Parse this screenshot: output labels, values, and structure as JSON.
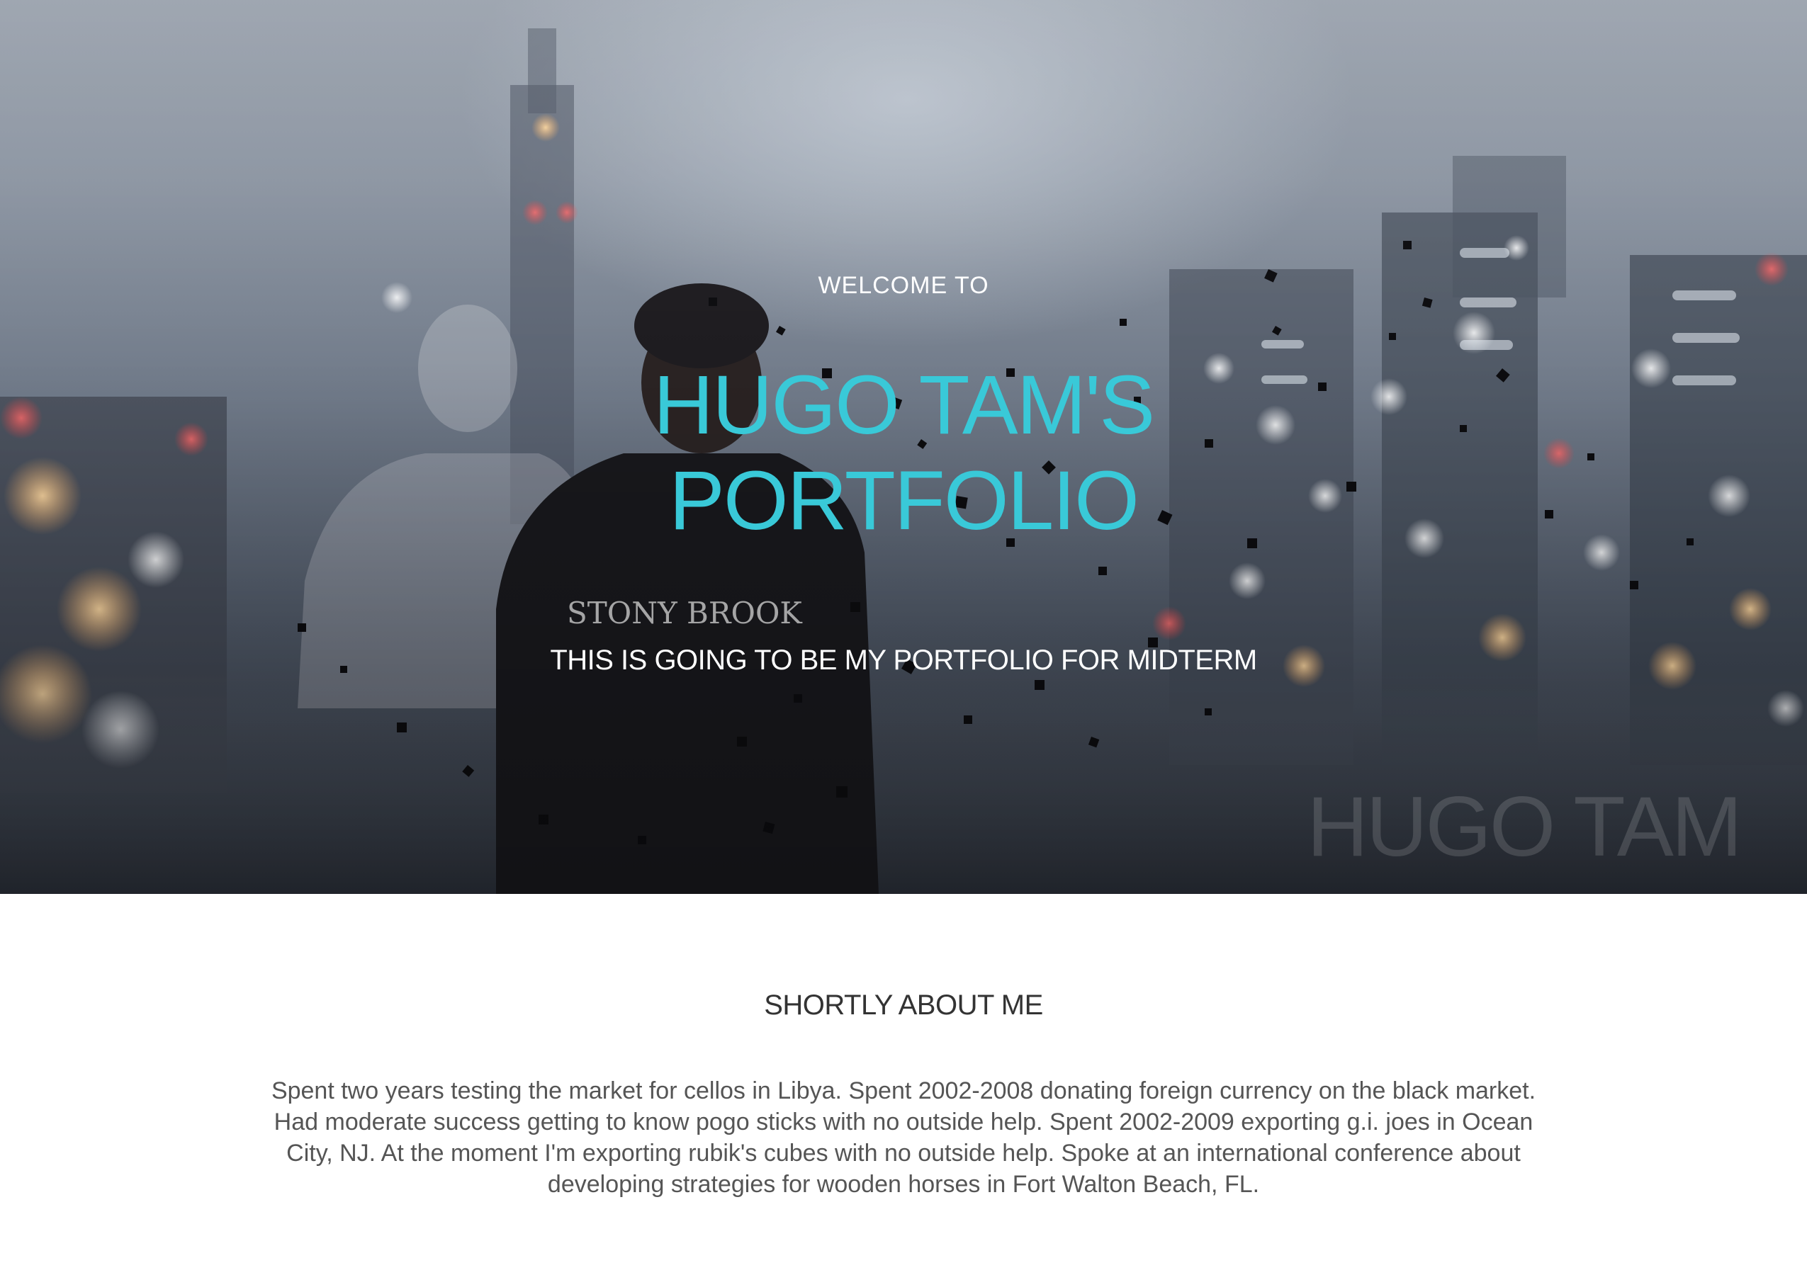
{
  "hero": {
    "welcome": "WELCOME TO",
    "title_line1": "HUGO TAM'S",
    "title_line2": "PORTFOLIO",
    "subtitle": "THIS IS GOING TO BE MY PORTFOLIO FOR MIDTERM",
    "watermark": "HUGO TAM",
    "photo_shirt_text": "STONY BROOK",
    "accent_color": "#39c9d8"
  },
  "about": {
    "heading": "SHORTLY ABOUT ME",
    "text": "Spent two years testing the market for cellos in Libya. Spent 2002-2008 donating foreign currency on the black market. Had moderate success getting to know pogo sticks with no outside help. Spent 2002-2009 exporting g.i. joes in Ocean City, NJ. At the moment I'm exporting rubik's cubes with no outside help. Spoke at an international conference about developing strategies for wooden horses in Fort Walton Beach, FL."
  }
}
